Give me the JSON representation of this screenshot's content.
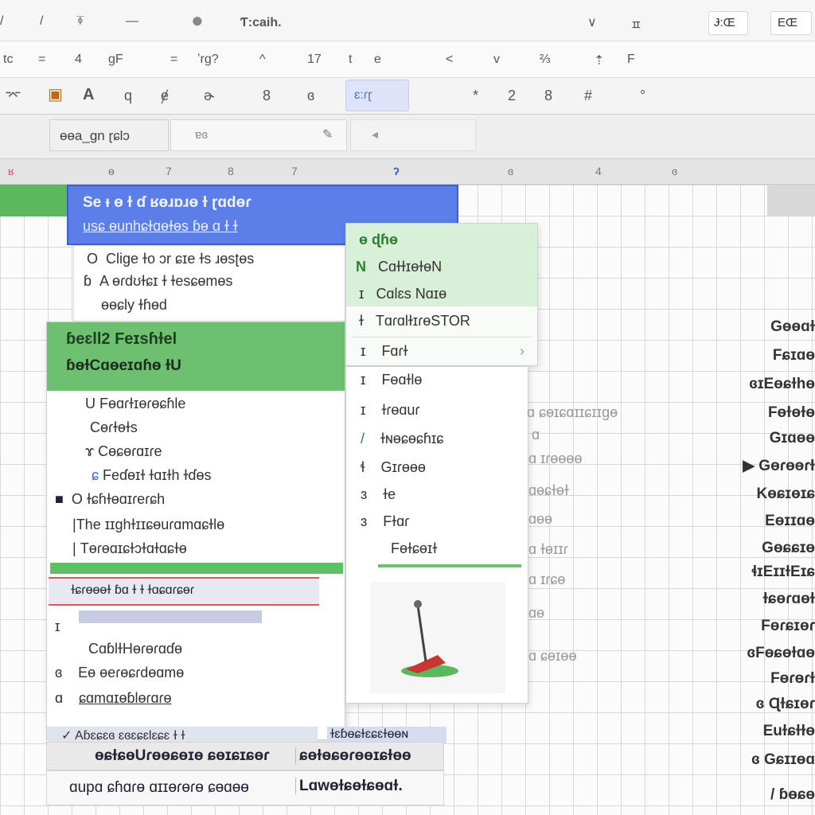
{
  "toolbar1": {
    "title": "Ƭ:caih.",
    "right_btn1": "Ɉ:Œ",
    "right_btn2": "EŒ",
    "glyphs": [
      "/",
      "/",
      "⍕",
      "—",
      "∨",
      "ㅍ"
    ]
  },
  "toolbar2": {
    "items": [
      "tc",
      "=",
      "4",
      "gF",
      "=",
      "ʼrg?",
      "^",
      "17",
      "t",
      "e",
      "<",
      "v",
      "⅔",
      "⇡",
      "F"
    ]
  },
  "toolbar3": {
    "items": [
      "⌤",
      "A",
      "q",
      "ɇ",
      "ɚ",
      "8",
      "ɞ",
      "*",
      "2",
      "8",
      "#",
      "°"
    ],
    "highlight": "ɛ:ɾɽ"
  },
  "formula_bar": {
    "name_box": "ɵɵa_gn ɽɕlɔ",
    "fx": "ɐɞ"
  },
  "column_headers": [
    "ʁ",
    "ɵ",
    "7",
    "8",
    "7",
    "ʔ",
    "ɞ",
    "4",
    "ɞ"
  ],
  "selection": {
    "line1": "Se  ᵻ  ɵ ɫ  ɗ  ʁɵɹɒɹɵ ɫ  ɽɑdɵɾ",
    "line2": "usɕ ɵunhɕɫɑɵɫɵs ɓɵ ɑ ɫ ɫ"
  },
  "top_panel": {
    "items": [
      {
        "marker": "O",
        "text": "Cliɡe ɫo ɔr ɕɪe ɫs ɹɵsʈɵs"
      },
      {
        "marker": "ɓ",
        "text": "A ɵɾdʊɫɕɪ ɫ ɫesɕɵmɵs"
      },
      {
        "marker": "",
        "text": "ɵɵɕly ɫɦɵd"
      }
    ]
  },
  "left_menu": {
    "header1": "ɓeɛll2 Feɪsɦɫel",
    "header2": "ɓɵɫCɑɵeɪɑɦɵ  ɫU",
    "items": [
      {
        "marker": "U",
        "text": "Fɵɑɾɫɪɵɾɵɕɦle"
      },
      {
        "marker": "",
        "text": "Cɵɾɫɵɫs"
      },
      {
        "marker": "ɤ",
        "text": "Cɵɕɵɾɑɪɾe"
      },
      {
        "marker": "ɕ",
        "text": "Feɗɵɪɫ ɫɑɪɫh ɫɗɵs"
      },
      {
        "marker": "O",
        "text": "ɫɕɦɫɵɑɪɾeɾɕh"
      },
      {
        "marker": "|",
        "text": "The ɪɪɡhɫɪɪɕɵuɾɑmɑɕɫlɵ"
      },
      {
        "marker": "|",
        "text": "Tɵɾɵɑɪɕɫɔɫɑɫɑɕɫɵ"
      }
    ],
    "redbar": "ɫɕɾɵɵɵɫ ɓɑ ɫ ɫ ɫɑɕɑɾɕɵɾ",
    "items2": [
      {
        "marker": "ɪ",
        "text": ""
      },
      {
        "marker": "",
        "text": "CɑɓlɫHɵɾɵɾɑɗɵ"
      },
      {
        "marker": "ɞ",
        "text": "Eɵ ɵeɾɵɕɾdɵɑmɵ"
      },
      {
        "marker": "ɑ",
        "text": "ɕɑmɑɪɵɓlɵɾɑɾɵ"
      }
    ],
    "check_row": "✓ Aɓɛɕɛɞ ɛɞɛɕɛlɛɕɛ ɫ ɫ",
    "check_row2": "ɫɛɓɵɕɫɛɕɛɫɵɵɴ"
  },
  "context_menu": {
    "items": [
      {
        "marker": "ɵ",
        "text": "ɖɦɵ"
      },
      {
        "marker": "N",
        "text": "CɑɫɫɪɵɫɵN"
      },
      {
        "marker": "ɪ",
        "text": "Cɑlɛs Nɑɪɵ"
      },
      {
        "marker": "ɫ",
        "text": "TɑɾɑlɫɪɾɵSTOR"
      },
      {
        "marker": "ɪ",
        "text": "Fɑɾɫ"
      }
    ]
  },
  "context_menu2": {
    "items": [
      {
        "marker": "ɪ",
        "text": "Fɵɑɫlɵ"
      },
      {
        "marker": "ɪ",
        "text": "ɫɾɵɑuɾ"
      },
      {
        "marker": "/",
        "text": "ɫɴɵɕɵɕɦɪɕ"
      },
      {
        "marker": "ɬ",
        "text": "Gɪɾɵɵɵ"
      },
      {
        "marker": "ɜ",
        "text": "ɫe"
      },
      {
        "marker": "ɜ",
        "text": "Fɫɑɾ"
      },
      {
        "marker": "",
        "text": "Fɵɫɕɵɪɫ"
      }
    ]
  },
  "right_column": [
    "Gɵɵɑɫ",
    "Fɕɪɑɵ",
    "ɞɪEɵɕɫhɵ",
    "Fɵɫɵɫɵ",
    "Gɪɑɵɵ",
    "▶ Gɵɾɵɵɾɫ",
    "Kɵɕɪɵɪɕ",
    "Eɵɪɪɑɵ",
    "Gɵɕɕɪɵ",
    "ɬɪEɪɪɫEɪɕ",
    "ɫɕɵɾɑɵɫ",
    "Fɵɾɕɪɵɾ",
    "ɞFɵɕɵɫɑɵ",
    "Fɵɾɵɾɫ",
    "ɞ Ɋɫɕɪɵɾ",
    "Euɫɕɫɫɵ",
    "ɞ Gɕɪɪɵɑ",
    "/ ɓɵɕɵ"
  ],
  "mid_column": [
    "ɑ ɕɵɪɕɑɪɪɕɪɪɡɵ",
    "ɑ",
    "ɑ ɪɾɵɵɵɵ",
    "ɑɵɕɫɵɫ",
    "ɑɵɵ",
    "ɑ ɫɵɪɪɾ",
    "ɑ ɪɾɕɵ",
    "ɑɵ",
    "ɑ ɕɵɪɵɵ"
  ],
  "bottom": {
    "row1_left": "ɵɕɫɕɵUɾɵɵɕɵɪɵ ɕɵɪɕɪɕɵɾ",
    "row1_right": "ɕɵɫɵɕɵɾɵɵɪɕɫɵɵ",
    "row2_left": "ɑupɑ ɕɦɑɾɵ ɑɪɪɵɾɵɾɵ ɕɵɑɵɵ",
    "row2_right": "Lɑwɵɫɕɵɫɕɵɑɫ."
  },
  "colors": {
    "accent_blue": "#5b7ee8",
    "accent_green": "#5cb85c",
    "context_green": "#d8efd8"
  }
}
